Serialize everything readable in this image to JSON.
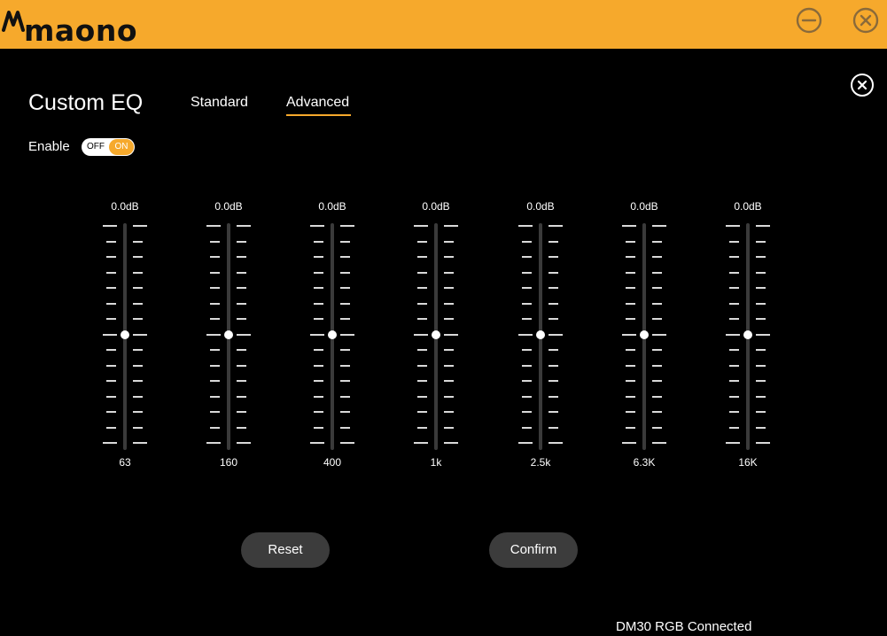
{
  "header": {
    "brand": "maono",
    "minimize_icon": "minus-circle-icon",
    "close_icon": "close-circle-icon"
  },
  "panel": {
    "title": "Custom EQ",
    "close_icon": "close-circle-icon"
  },
  "tabs": [
    {
      "label": "Standard",
      "active": false
    },
    {
      "label": "Advanced",
      "active": true
    }
  ],
  "enable": {
    "label": "Enable",
    "off_label": "OFF",
    "on_label": "ON",
    "state": "on"
  },
  "eq": {
    "min_db": -12,
    "max_db": 12,
    "bands": [
      {
        "label": "63",
        "value_text": "0.0dB",
        "value": 0
      },
      {
        "label": "160",
        "value_text": "0.0dB",
        "value": 0
      },
      {
        "label": "400",
        "value_text": "0.0dB",
        "value": 0
      },
      {
        "label": "1k",
        "value_text": "0.0dB",
        "value": 0
      },
      {
        "label": "2.5k",
        "value_text": "0.0dB",
        "value": 0
      },
      {
        "label": "6.3K",
        "value_text": "0.0dB",
        "value": 0
      },
      {
        "label": "16K",
        "value_text": "0.0dB",
        "value": 0
      }
    ]
  },
  "buttons": {
    "reset": "Reset",
    "confirm": "Confirm"
  },
  "status": {
    "text": "DM30 RGB Connected"
  },
  "colors": {
    "accent": "#f6a92c",
    "background": "#000000",
    "button": "#3c3c3c",
    "track": "#3a3a3a"
  }
}
